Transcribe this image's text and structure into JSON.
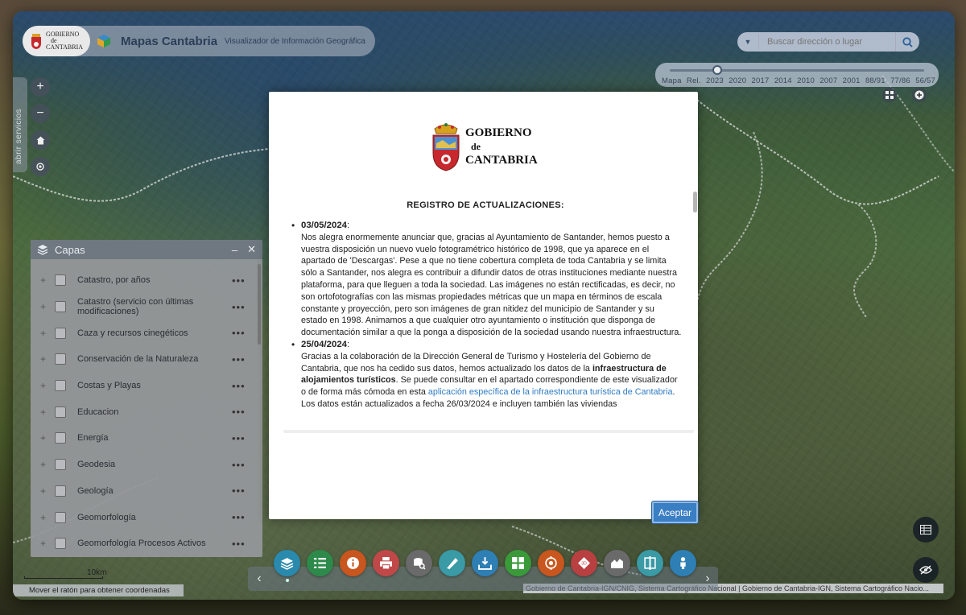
{
  "app": {
    "logo_text": [
      "GOBIERNO",
      "de",
      "CANTABRIA"
    ],
    "title": "Mapas Cantabria",
    "subtitle": "Visualizador de Información Geográfica"
  },
  "search": {
    "placeholder": "Buscar dirección o lugar"
  },
  "timeline": {
    "labels": [
      "Mapa",
      "Rel.",
      "2023",
      "2020",
      "2017",
      "2014",
      "2010",
      "2007",
      "2001",
      "88/91",
      "77/86",
      "56/57"
    ],
    "selected": "2023"
  },
  "services_tab": {
    "label": "abrir servicios"
  },
  "layers_panel": {
    "title": "Capas",
    "items": [
      "Catastro, por años",
      "Catastro (servicio con últimas modificaciones)",
      "Caza y recursos cinegéticos",
      "Conservación de la Naturaleza",
      "Costas y Playas",
      "Educacion",
      "Energía",
      "Geodesia",
      "Geología",
      "Geomorfología",
      "Geomorfología Procesos Activos"
    ]
  },
  "scale": {
    "label": "10km"
  },
  "coords": {
    "text": "Mover el ratón para obtener coordenadas"
  },
  "attribution": {
    "text": "Gobierno de Cantabria-IGN/CNIG, Sistema Cartográfico Nacional | Gobierno de Cantabria-IGN, Sistema Cartográfico Nacio..."
  },
  "toolbar": {
    "tools": [
      {
        "icon": "layers-icon",
        "color": "#2a8aae"
      },
      {
        "icon": "legend-list-icon",
        "color": "#2d8a4a"
      },
      {
        "icon": "info-icon",
        "color": "#c8561e"
      },
      {
        "icon": "print-icon",
        "color": "#c04848"
      },
      {
        "icon": "query-icon",
        "color": "#6a6a6a"
      },
      {
        "icon": "measure-icon",
        "color": "#3a9aa6"
      },
      {
        "icon": "download-icon",
        "color": "#2e7fb4"
      },
      {
        "icon": "grid-icon",
        "color": "#3a9a3a"
      },
      {
        "icon": "target-icon",
        "color": "#c8561e"
      },
      {
        "icon": "3d-icon",
        "color": "#b84040"
      },
      {
        "icon": "profile-icon",
        "color": "#6a6a6a"
      },
      {
        "icon": "compare-icon",
        "color": "#3a9aa6"
      },
      {
        "icon": "streetview-icon",
        "color": "#2e7fb4"
      }
    ]
  },
  "modal": {
    "logo_text": {
      "line1": "GOBIERNO",
      "line2": "de",
      "line3": "CANTABRIA"
    },
    "heading": "REGISTRO DE ACTUALIZACIONES:",
    "entries": [
      {
        "date": "03/05/2024",
        "text": "Nos alegra enormemente anunciar que, gracias al Ayuntamiento de Santander, hemos puesto a vuestra disposición un nuevo vuelo fotogramétrico histórico de 1998, que ya aparece en el apartado de 'Descargas'. Pese a que no tiene cobertura completa de toda Cantabria y se limita sólo a Santander, nos alegra es contribuir a difundir datos de otras instituciones mediante nuestra plataforma, para que lleguen a toda la sociedad. Las imágenes no están rectificadas, es decir, no son ortofotografías con las mismas propiedades métricas que un mapa en términos de escala constante y proyección, pero son imágenes de gran nitidez del municipio de Santander y su estado en 1998. Animamos a que cualquier otro ayuntamiento o institución que disponga de documentación similar a que la ponga a disposición de la sociedad usando nuestra infraestructura."
      },
      {
        "date": "25/04/2024",
        "text_before": "Gracias a la colaboración de la Dirección General de Turismo y Hostelería del Gobierno de Cantabria, que nos ha cedido sus datos, hemos actualizado los datos de la ",
        "bold": "infraestructura de alojamientos turísticos",
        "text_mid": ". Se puede consultar en el apartado correspondiente de este visualizador o de forma más cómoda en esta ",
        "link": "aplicación específica de la infraestructura turística de Cantabria",
        "text_after": ". Los datos están actualizados a fecha 26/03/2024 e incluyen también las viviendas"
      }
    ],
    "accept_label": "Aceptar"
  }
}
